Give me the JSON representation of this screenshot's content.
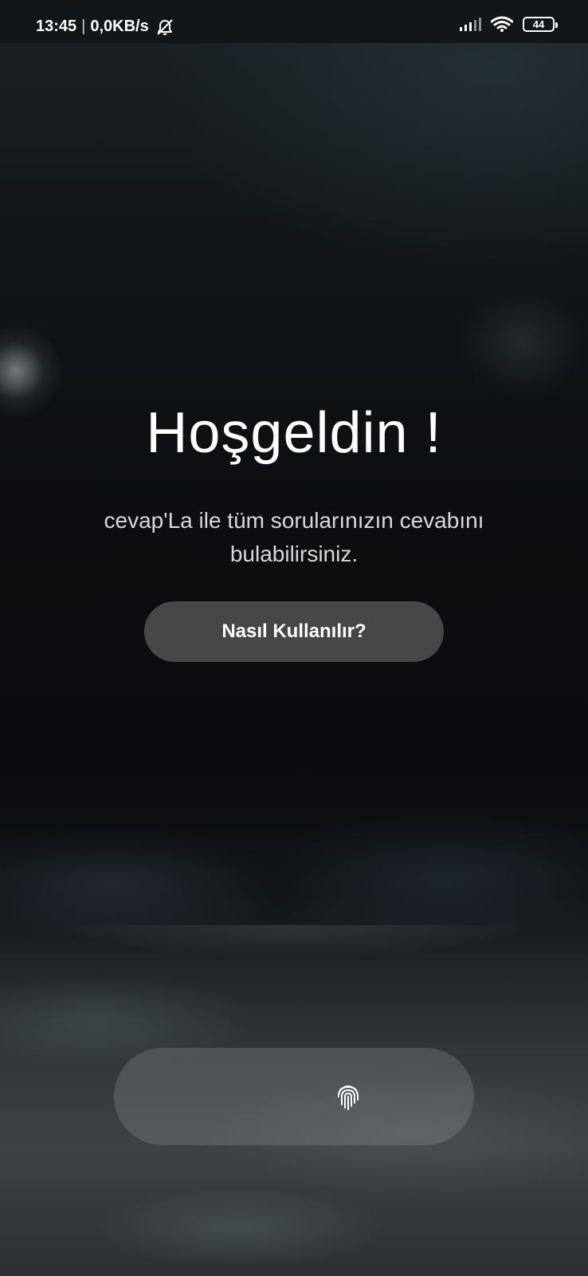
{
  "status_bar": {
    "time": "13:45",
    "separator": "|",
    "network_speed": "0,0KB/s",
    "battery_level": "44",
    "battery_fraction": 0.44,
    "icons": [
      "bell-off-icon",
      "signal-icon",
      "wifi-icon",
      "battery-icon"
    ]
  },
  "main": {
    "title": "Hoşgeldin !",
    "subtitle": "cevap'La ile tüm sorularınızın cevabını bulabilirsiniz.",
    "how_to_button_label": "Nasıl Kullanılır?"
  },
  "fingerprint": {
    "icon": "fingerprint-icon"
  },
  "colors": {
    "button_bg": "#474747",
    "text_primary": "#ffffff",
    "text_secondary": "#d6d8da"
  }
}
